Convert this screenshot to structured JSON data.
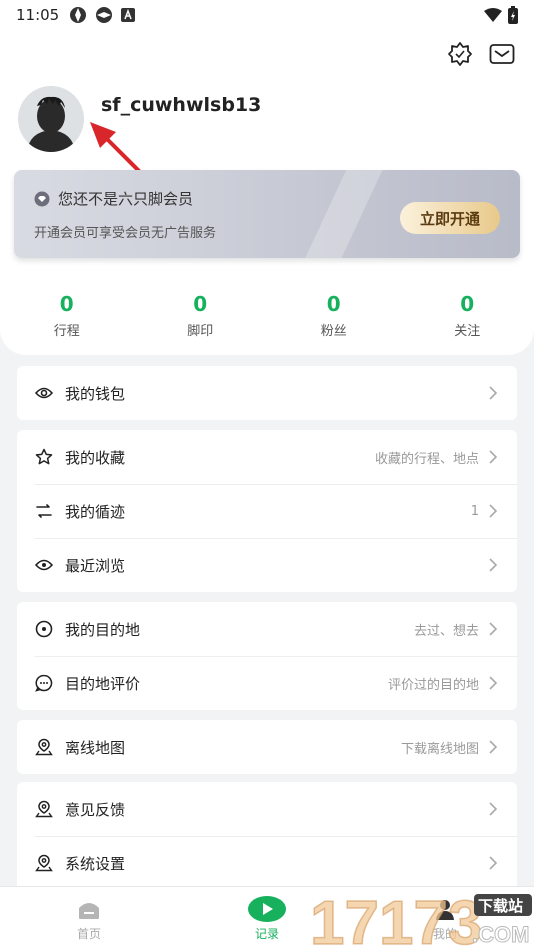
{
  "status_bar": {
    "time": "11:05"
  },
  "profile": {
    "username": "sf_cuwhwlsb13"
  },
  "member": {
    "title": "您还不是六只脚会员",
    "desc": "开通会员可享受会员无广告服务",
    "button": "立即开通"
  },
  "stats": [
    {
      "value": "0",
      "label": "行程"
    },
    {
      "value": "0",
      "label": "脚印"
    },
    {
      "value": "0",
      "label": "粉丝"
    },
    {
      "value": "0",
      "label": "关注"
    }
  ],
  "menu": {
    "wallet": {
      "label": "我的钱包"
    },
    "favorites": {
      "label": "我的收藏",
      "hint": "收藏的行程、地点"
    },
    "tracks": {
      "label": "我的循迹",
      "hint": "1"
    },
    "recent": {
      "label": "最近浏览"
    },
    "destination": {
      "label": "我的目的地",
      "hint": "去过、想去"
    },
    "review": {
      "label": "目的地评价",
      "hint": "评价过的目的地"
    },
    "offline_map": {
      "label": "离线地图",
      "hint": "下载离线地图"
    },
    "feedback": {
      "label": "意见反馈"
    },
    "settings": {
      "label": "系统设置"
    }
  },
  "nav": [
    {
      "label": "首页",
      "icon": "home-icon"
    },
    {
      "label": "记录",
      "icon": "record-icon"
    },
    {
      "label": "我的",
      "icon": "profile-icon"
    }
  ],
  "watermark": {
    "number": "17173",
    "tag": "下载站",
    "domain": ".COM"
  },
  "colors": {
    "accent": "#17b15e",
    "arrow": "#d9262b"
  }
}
